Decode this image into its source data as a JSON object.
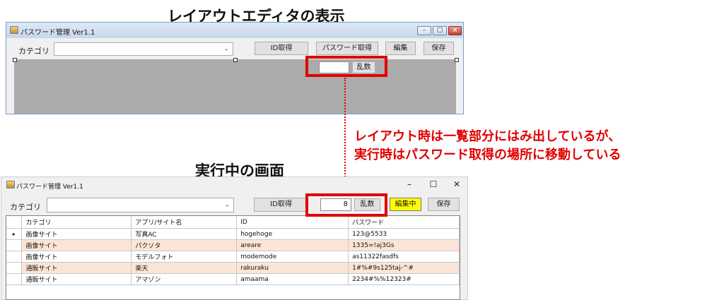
{
  "headings": {
    "designer": "レイアウトエディタの表示",
    "runtime": "実行中の画面"
  },
  "annotation": {
    "line1": "レイアウト時は一覧部分にはみ出しているが、",
    "line2": "実行時はパスワード取得の場所に移動している",
    "color": "#e00000"
  },
  "designer_window": {
    "title": "パスワード管理 Ver1.1",
    "category_label": "カテゴリ",
    "category_value": "",
    "buttons": {
      "id": "ID取得",
      "password": "パスワード取得",
      "edit": "編集",
      "save": "保存",
      "random": "乱数"
    },
    "random_value": ""
  },
  "runtime_window": {
    "title": "パスワード管理 Ver1.1",
    "controls": {
      "minimize": "–",
      "maximize": "☐",
      "close": "✕"
    },
    "category_label": "カテゴリ",
    "category_value": "",
    "buttons": {
      "id": "ID取得",
      "random": "乱数",
      "edit": "編集中",
      "save": "保存"
    },
    "random_value": "8",
    "edit_highlight_color": "#ffff00",
    "grid": {
      "columns": [
        "カテゴリ",
        "アプリ/サイト名",
        "ID",
        "パスワード"
      ],
      "rows": [
        [
          "画像サイト",
          "写真AC",
          "hogehoge",
          "123@5533"
        ],
        [
          "画像サイト",
          "パクソタ",
          "areare",
          "1335=!aj3Gs"
        ],
        [
          "画像サイト",
          "モデルフォト",
          "modemode",
          "as11322fasdfs"
        ],
        [
          "通販サイト",
          "楽天",
          "rakuraku",
          "1#%#9s125taj-^#"
        ],
        [
          "通販サイト",
          "アマゾン",
          "amaama",
          "2234#%%12323#"
        ]
      ],
      "row_stripe_color": "#fbe5d6"
    }
  }
}
